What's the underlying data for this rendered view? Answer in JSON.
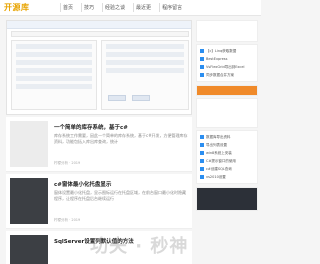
{
  "header": {
    "logo": "开源库",
    "nav": [
      "首页",
      "技巧",
      "经验之谈",
      "最近更",
      "程序留言"
    ]
  },
  "articles": [
    {
      "title": "一个简单的库存系统，基于c#",
      "text": "库存系统工作需要，因此一个简单的库存系统，基于c#开发，方便管理库存资料，功能包括入库出库查询，统计",
      "meta": "柠檬分析 · 2019"
    },
    {
      "title": "c#窗体最小化托盘显示",
      "text": "窗体设置最小化托盘，显示图标运行在托盘区域，在前台窗口最小化时隐藏程序，让程序在托盘后台继续运行",
      "meta": "柠檬分析 · 2019"
    },
    {
      "title": "SqlServer设置列默认值的方法",
      "text": "",
      "meta": ""
    }
  ],
  "sidebar": {
    "list1": [
      "【c】Linq获取数据",
      "BestExpress",
      "VsFlexGrid导出到Excel",
      "同步数据合并方案"
    ],
    "list2": [
      "数据库导出资料",
      "导出列表设置",
      "win8系统上安装",
      "C#提示窗口的使用",
      "c#创建SQL查询",
      "vs2010设置"
    ]
  },
  "watermark": "功夫 · 秒神"
}
